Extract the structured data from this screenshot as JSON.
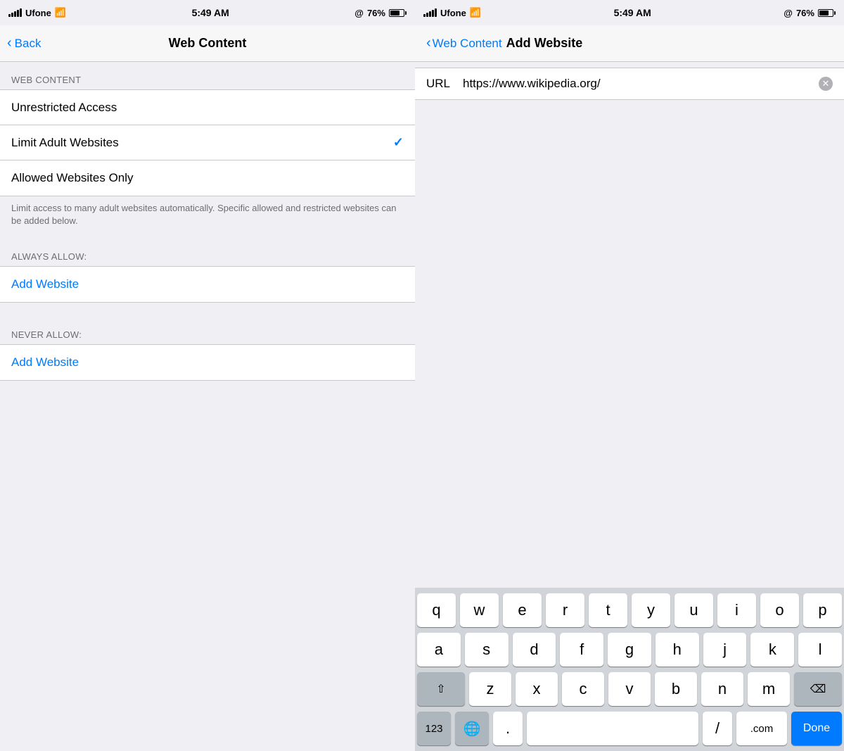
{
  "left": {
    "status": {
      "carrier": "Ufone",
      "time": "5:49 AM",
      "battery": "76%"
    },
    "nav": {
      "back_label": "Back",
      "title": "Web Content"
    },
    "section_header": "WEB CONTENT",
    "items": [
      {
        "label": "Unrestricted Access",
        "checked": false
      },
      {
        "label": "Limit Adult Websites",
        "checked": true
      },
      {
        "label": "Allowed Websites Only",
        "checked": false
      }
    ],
    "footer": "Limit access to many adult websites automatically. Specific allowed and restricted websites can be added below.",
    "always_allow": {
      "header": "ALWAYS ALLOW:",
      "add_label": "Add Website"
    },
    "never_allow": {
      "header": "NEVER ALLOW:",
      "add_label": "Add Website"
    }
  },
  "right": {
    "status": {
      "carrier": "Ufone",
      "time": "5:49 AM",
      "battery": "76%"
    },
    "nav": {
      "back_label": "Web Content",
      "title": "Add Website"
    },
    "url_label": "URL",
    "url_value": "https://www.wikipedia.org/",
    "keyboard": {
      "row1": [
        "q",
        "w",
        "e",
        "r",
        "t",
        "y",
        "u",
        "i",
        "o",
        "p"
      ],
      "row2": [
        "a",
        "s",
        "d",
        "f",
        "g",
        "h",
        "j",
        "k",
        "l"
      ],
      "row3": [
        "z",
        "x",
        "c",
        "v",
        "b",
        "n",
        "m"
      ],
      "bottom": {
        "num": "123",
        "dot": ".",
        "slash": "/",
        "dotcom": ".com",
        "done": "Done"
      }
    }
  }
}
